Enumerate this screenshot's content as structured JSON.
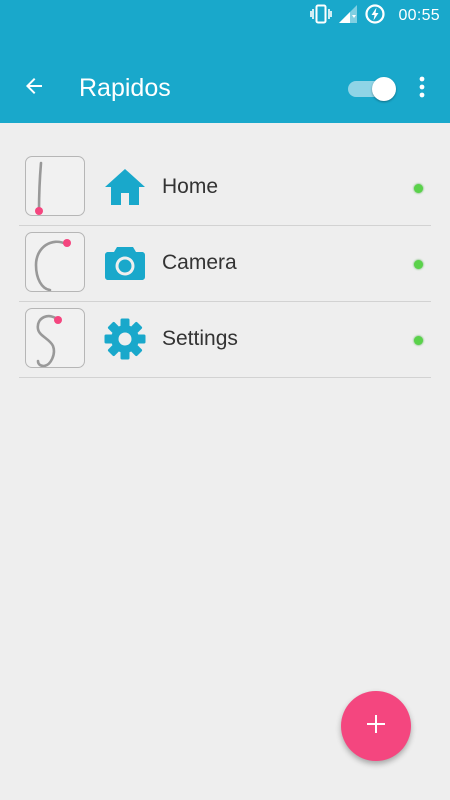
{
  "status_bar": {
    "time": "00:55",
    "icons": [
      "vibrate-icon",
      "signal-icon",
      "data-saver-icon"
    ]
  },
  "toolbar": {
    "title": "Rapidos",
    "back_icon": "arrow-back-icon",
    "toggle_on": true,
    "menu_icon": "more-vert-icon"
  },
  "shortcuts": [
    {
      "label": "Home",
      "gesture": "I",
      "icon": "home-icon",
      "active": true
    },
    {
      "label": "Camera",
      "gesture": "C",
      "icon": "camera-icon",
      "active": true
    },
    {
      "label": "Settings",
      "gesture": "S",
      "icon": "settings-gear-icon",
      "active": true
    }
  ],
  "fab": {
    "icon": "plus-icon"
  },
  "colors": {
    "primary": "#19a8cb",
    "accent": "#f4467f",
    "active_dot": "#5ad24a",
    "gesture_stroke": "#999999",
    "gesture_start": "#f4467f"
  }
}
